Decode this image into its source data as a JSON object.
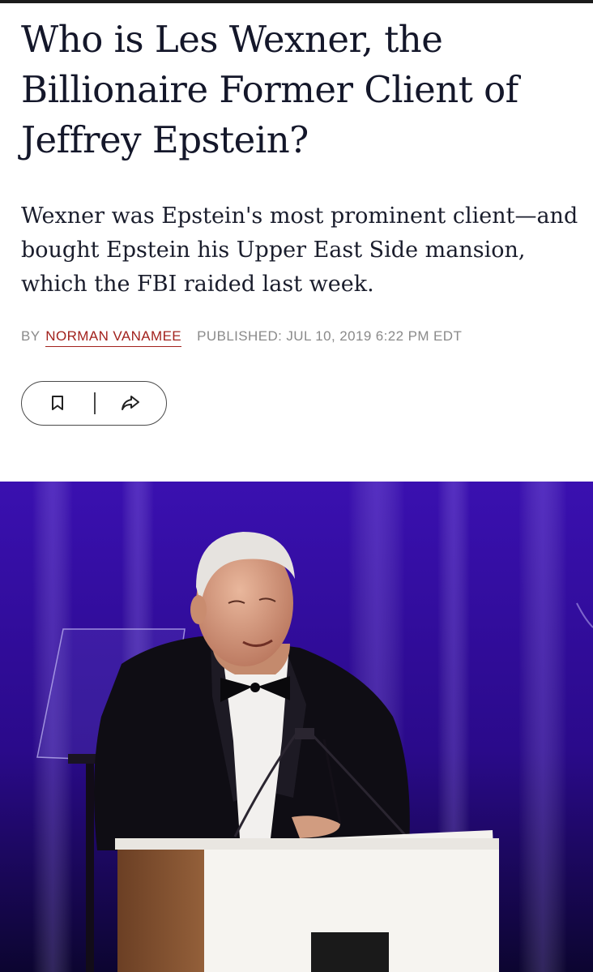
{
  "article": {
    "headline": "Who is Les Wexner, the Billionaire Former Client of Jeffrey Epstein?",
    "dek": "Wexner was Epstein's most prominent client—and bought Epstein his Upper East Side mansion, which the FBI raided last week.",
    "byline": {
      "by_label": "BY",
      "author": "NORMAN VANAMEE",
      "published": "PUBLISHED: JUL 10, 2019 6:22 PM EDT"
    }
  },
  "actions": {
    "bookmark_icon": "bookmark-icon",
    "share_icon": "share-icon"
  },
  "colors": {
    "headline": "#14172a",
    "author_link": "#a2221d",
    "meta": "#8a8a8a",
    "hero_background": "#3a10b0"
  }
}
